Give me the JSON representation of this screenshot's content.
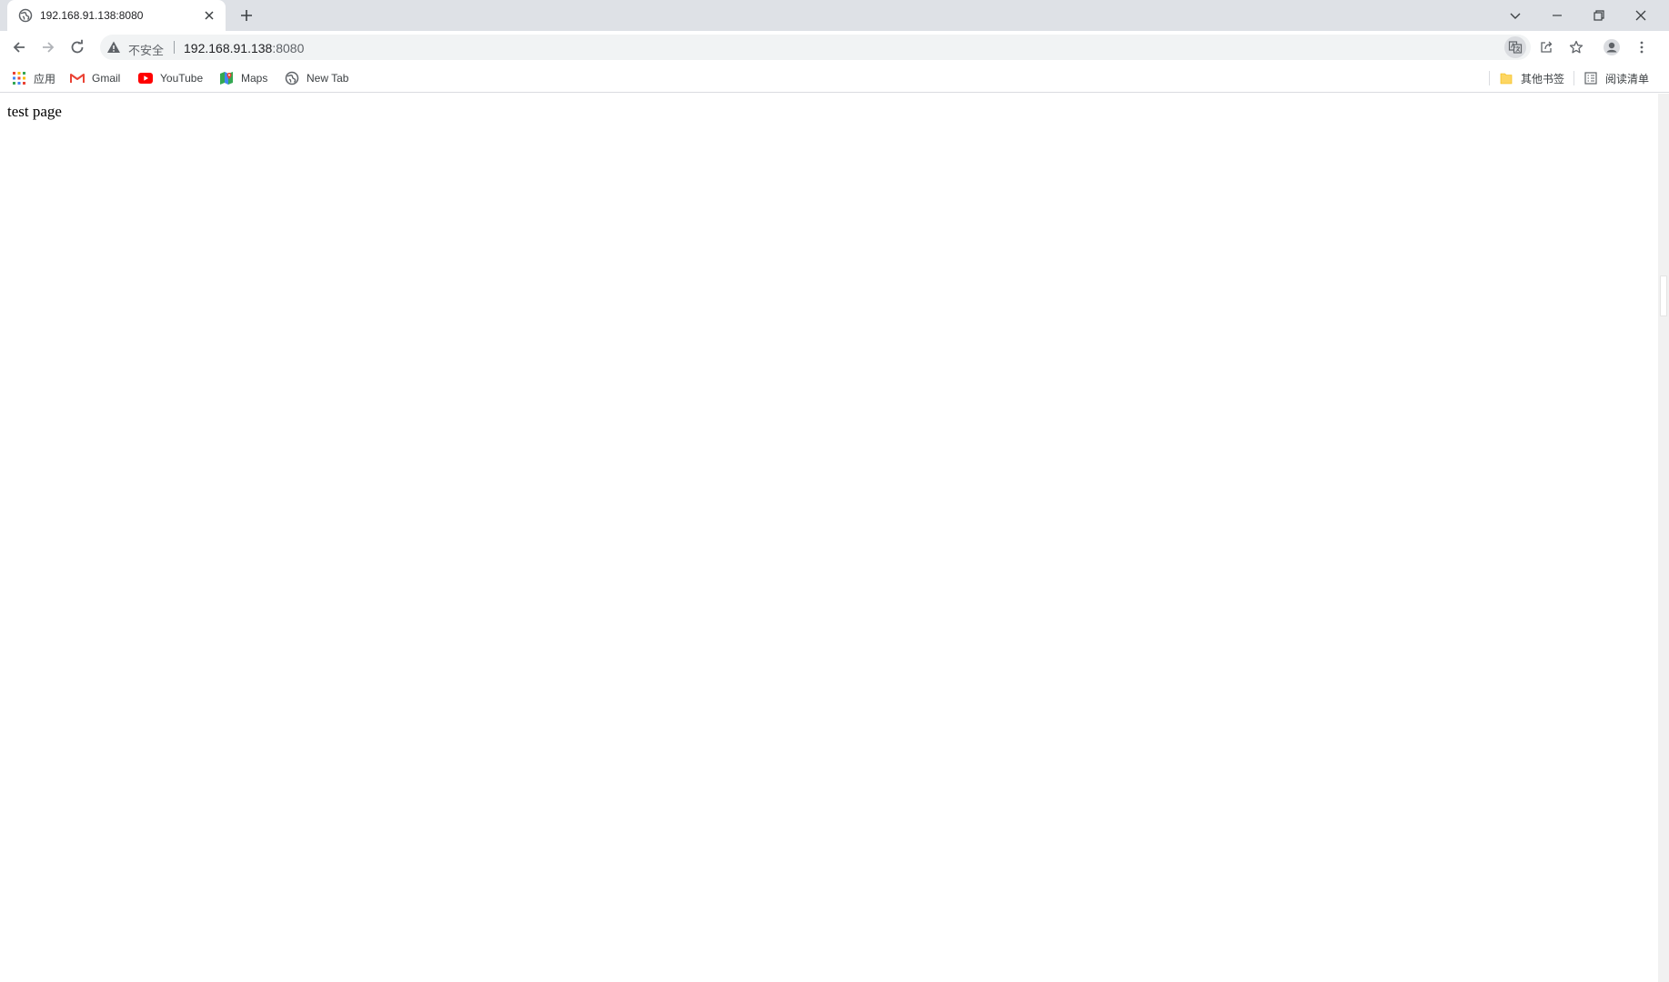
{
  "tab": {
    "title": "192.168.91.138:8080",
    "favicon": "globe-icon"
  },
  "window_controls": [
    "tab-search-icon",
    "minimize-icon",
    "restore-icon",
    "close-icon"
  ],
  "toolbar": {
    "security_label": "不安全",
    "url_host": "192.168.91.138",
    "url_port": ":8080"
  },
  "bookmarks": {
    "items": [
      {
        "label": "应用",
        "icon": "apps-grid-icon"
      },
      {
        "label": "Gmail",
        "icon": "gmail-icon"
      },
      {
        "label": "YouTube",
        "icon": "youtube-icon"
      },
      {
        "label": "Maps",
        "icon": "maps-icon"
      },
      {
        "label": "New Tab",
        "icon": "globe-icon"
      }
    ],
    "other_bookmarks": "其他书签",
    "reading_list": "阅读清单"
  },
  "page": {
    "text": "test page"
  },
  "colors": {
    "tab_strip": "#dee1e6",
    "omnibox": "#f1f3f4",
    "youtube_red": "#ff0000",
    "gmail_red": "#ea4335",
    "folder_yellow": "#fdd663"
  }
}
